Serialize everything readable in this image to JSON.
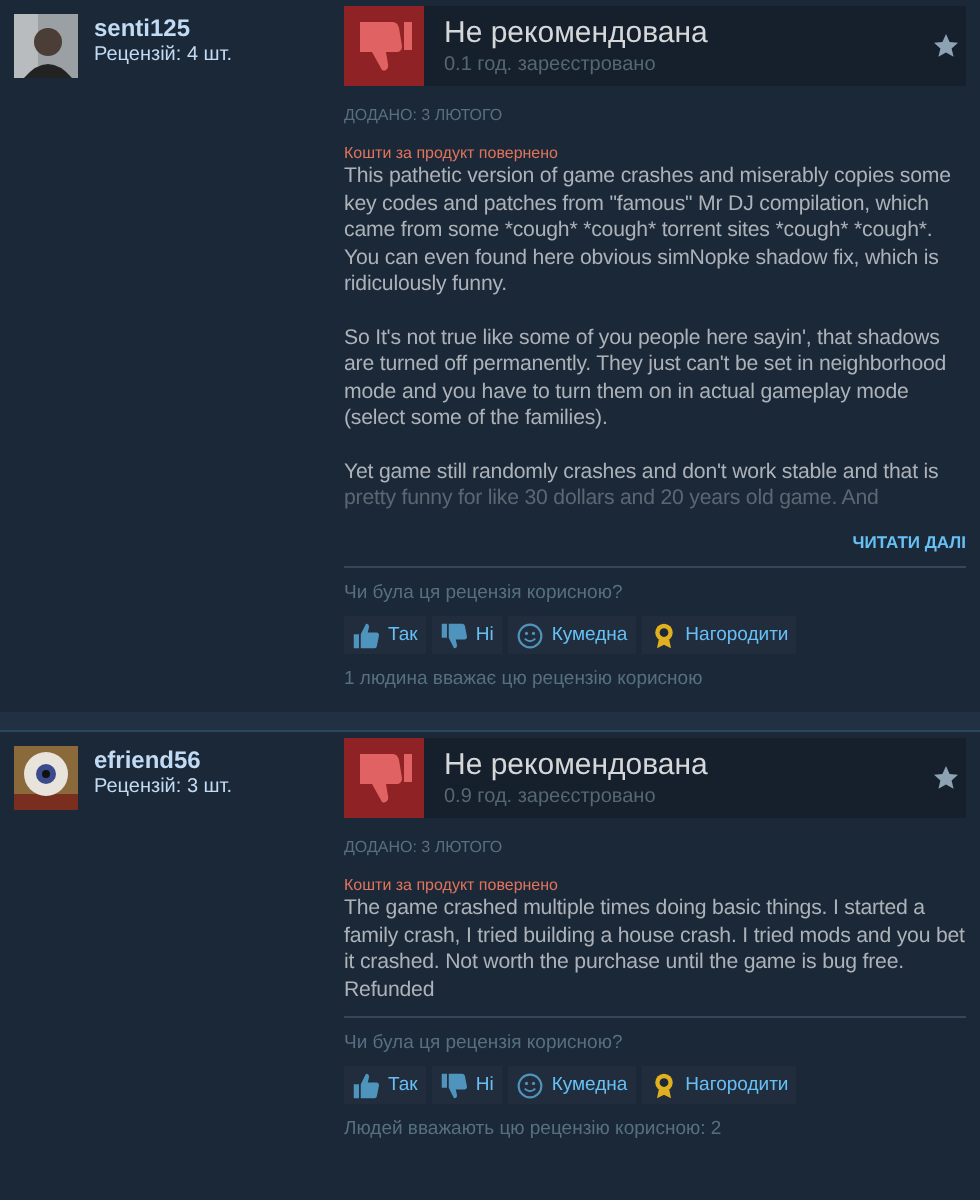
{
  "reviews": [
    {
      "author": "senti125",
      "review_count": "Рецензій: 4 шт.",
      "verdict": "Не рекомендована",
      "hours": "0.1 год. зареєстровано",
      "posted": "ДОДАНО: 3 ЛЮТОГО",
      "refund_note": "Кошти за продукт повернено",
      "paragraphs": [
        "This pathetic version of game crashes and miserably copies some key codes and patches from \"famous\" Mr DJ compilation, which came from some *cough* *cough* torrent sites *cough* *cough*. You can even found here obvious simNopke shadow fix, which is ridiculously funny.",
        "So It's not true like some of you people here sayin', that shadows are turned off permanently. They just can't be set in neighborhood mode and you have to turn them on in actual gameplay mode (select some of the families).",
        "Yet game still randomly crashes and don't work stable and that is pretty funny for like 30 dollars and 20 years old game. And"
      ],
      "truncated": true,
      "read_more": "ЧИТАТИ ДАЛІ",
      "question": "Чи була ця рецензія корисною?",
      "votes": [
        {
          "kind": "up",
          "label": "Так"
        },
        {
          "kind": "down",
          "label": "Ні"
        },
        {
          "kind": "funny",
          "label": "Кумедна"
        },
        {
          "kind": "award",
          "label": "Нагородити"
        }
      ],
      "helpful": "1 людина вважає цю рецензію корисною"
    },
    {
      "author": "efriend56",
      "review_count": "Рецензій: 3 шт.",
      "verdict": "Не рекомендована",
      "hours": "0.9 год. зареєстровано",
      "posted": "ДОДАНО: 3 ЛЮТОГО",
      "refund_note": "Кошти за продукт повернено",
      "paragraphs": [
        "The game crashed multiple times doing basic things. I started a family crash, I tried building a house crash. I tried mods and you bet it crashed. Not worth the purchase until the game is bug free. Refunded"
      ],
      "truncated": false,
      "question": "Чи була ця рецензія корисною?",
      "votes": [
        {
          "kind": "up",
          "label": "Так"
        },
        {
          "kind": "down",
          "label": "Ні"
        },
        {
          "kind": "funny",
          "label": "Кумедна"
        },
        {
          "kind": "award",
          "label": "Нагородити"
        }
      ],
      "helpful": "Людей вважають цю рецензію корисною: 2"
    }
  ]
}
